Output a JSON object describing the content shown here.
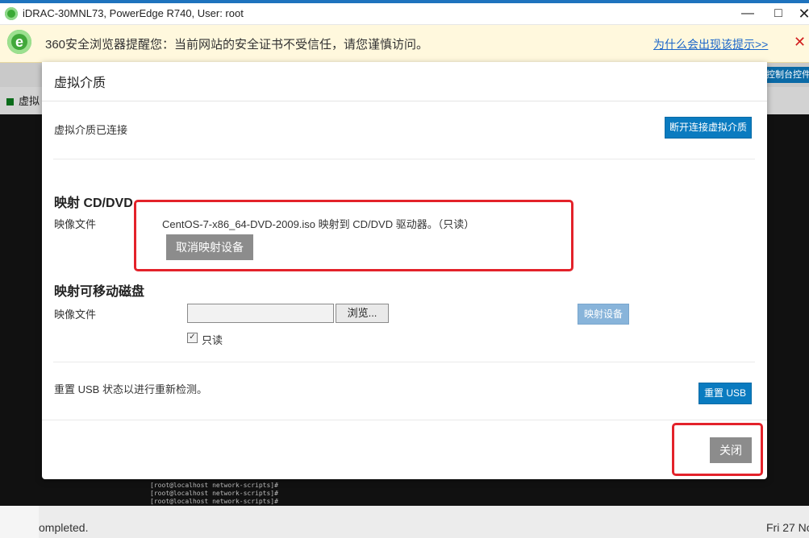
{
  "window": {
    "title": "iDRAC-30MNL73, PowerEdge R740, User: root",
    "min_glyph": "—",
    "max_glyph": "□",
    "close_glyph": "✕"
  },
  "warning_bar": {
    "message": "360安全浏览器提醒您：当前网站的安全证书不受信任，请您谨慎访问。",
    "link": "为什么会出现该提示>>",
    "close_glyph": "✕",
    "icon_letter": "e"
  },
  "background": {
    "left_label": "虚拟",
    "right_button": "控制台控件",
    "console_lines": [
      "[root@localhost network-scripts]#",
      "[root@localhost network-scripts]#",
      "[root@localhost network-scripts]#"
    ],
    "status_left": "ompleted.",
    "status_right": "Fri 27 No"
  },
  "modal": {
    "title": "虚拟介质",
    "connected_text": "虚拟介质已连接",
    "disconnect_button": "断开连接虚拟介质",
    "cd": {
      "section_title": "映射 CD/DVD",
      "image_label": "映像文件",
      "mapped_text": "CentOS-7-x86_64-DVD-2009.iso 映射到 CD/DVD 驱动器。（只读）",
      "unmap_button": "取消映射设备"
    },
    "removable": {
      "section_title": "映射可移动磁盘",
      "image_label": "映像文件",
      "file_value": "",
      "browse_button": "浏览...",
      "map_button": "映射设备",
      "readonly_label": "只读",
      "readonly_checked": true,
      "check_glyph": "✓"
    },
    "usb": {
      "text": "重置 USB 状态以进行重新检测。",
      "button": "重置 USB"
    },
    "close_button": "关闭"
  },
  "colors": {
    "primary_button": "#0a7bc0",
    "disabled_button": "#88b4da",
    "gray_button": "#8c8c8c",
    "highlight": "#e3222a"
  }
}
